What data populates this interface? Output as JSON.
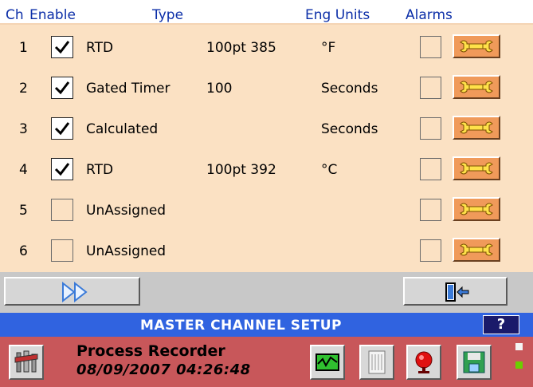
{
  "columns": {
    "ch": "Ch",
    "enable": "Enable",
    "type": "Type",
    "eng_units": "Eng Units",
    "alarms": "Alarms"
  },
  "rows": [
    {
      "ch": "1",
      "enabled": true,
      "type": "RTD",
      "range": "100pt 385",
      "units": "°F",
      "alarm": false
    },
    {
      "ch": "2",
      "enabled": true,
      "type": "Gated Timer",
      "range": "100",
      "units": "Seconds",
      "alarm": false
    },
    {
      "ch": "3",
      "enabled": true,
      "type": "Calculated",
      "range": "",
      "units": "Seconds",
      "alarm": false
    },
    {
      "ch": "4",
      "enabled": true,
      "type": "RTD",
      "range": "100pt 392",
      "units": "°C",
      "alarm": false
    },
    {
      "ch": "5",
      "enabled": false,
      "type": "UnAssigned",
      "range": "",
      "units": "",
      "alarm": false
    },
    {
      "ch": "6",
      "enabled": false,
      "type": "UnAssigned",
      "range": "",
      "units": "",
      "alarm": false
    }
  ],
  "title_bar": {
    "title": "MASTER CHANNEL SETUP",
    "help_label": "?"
  },
  "status_bar": {
    "app_name": "Process Recorder",
    "datetime": "08/09/2007 04:26:48"
  },
  "icons": {
    "next": "double-arrow-right-icon",
    "exit": "door-exit-icon",
    "tools": "tools-icon",
    "trend": "trend-display-icon",
    "list": "list-view-icon",
    "alarm": "alarm-bell-icon",
    "save": "save-disk-icon",
    "wrench": "wrench-icon"
  },
  "colors": {
    "header_text": "#0b2ea8",
    "table_bg": "#fbe1c3",
    "title_bar": "#3063e0",
    "status_bar": "#c8575a",
    "wrench_button": "#f09a5a",
    "led_on": "#6ad000"
  },
  "indicators": [
    {
      "name": "led-1",
      "on": false
    },
    {
      "name": "led-2",
      "on": true
    }
  ]
}
